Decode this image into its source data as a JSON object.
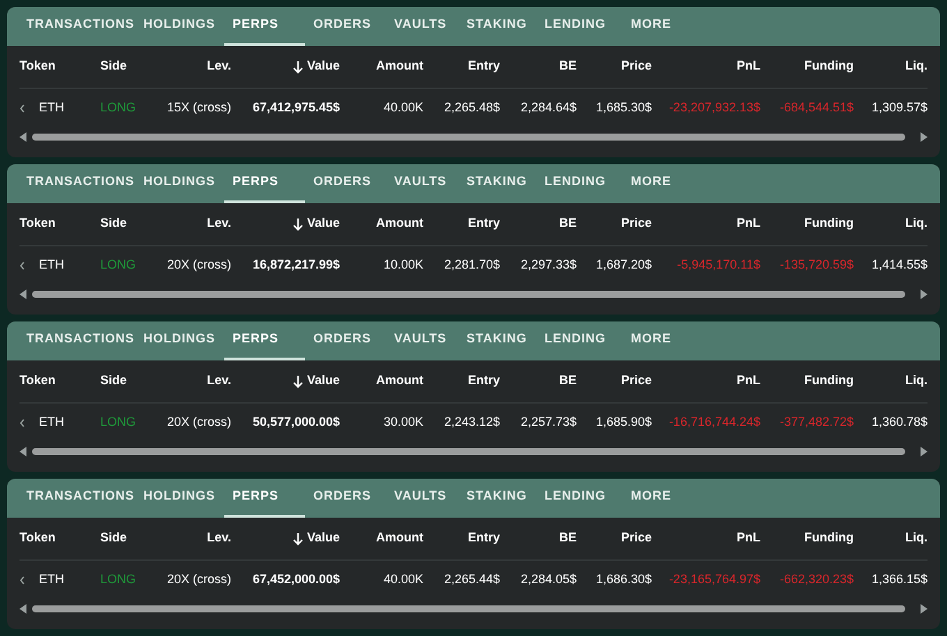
{
  "panels": [
    {
      "tabs": [
        {
          "label": "TRANSACTIONS",
          "selected": false
        },
        {
          "label": "HOLDINGS",
          "selected": false
        },
        {
          "label": "PERPS",
          "selected": true
        },
        {
          "label": "ORDERS",
          "selected": false
        },
        {
          "label": "VAULTS",
          "selected": false
        },
        {
          "label": "STAKING",
          "selected": false
        },
        {
          "label": "LENDING",
          "selected": false
        },
        {
          "label": "MORE",
          "selected": false
        }
      ],
      "columns": [
        {
          "label": "Token",
          "sorted": false
        },
        {
          "label": "Side",
          "sorted": false
        },
        {
          "label": "Lev.",
          "sorted": false
        },
        {
          "label": "Value",
          "sorted": true
        },
        {
          "label": "Amount",
          "sorted": false
        },
        {
          "label": "Entry",
          "sorted": false
        },
        {
          "label": "BE",
          "sorted": false
        },
        {
          "label": "Price",
          "sorted": false
        },
        {
          "label": "PnL",
          "sorted": false
        },
        {
          "label": "Funding",
          "sorted": false
        },
        {
          "label": "Liq.",
          "sorted": false
        }
      ],
      "rows": [
        [
          "ETH",
          "LONG",
          "15X (cross)",
          "67,412,975.45$",
          "40.00K",
          "2,265.48$",
          "2,284.64$",
          "1,685.30$",
          "-23,207,932.13$",
          "-684,544.51$",
          "1,309.57$"
        ]
      ]
    },
    {
      "tabs": [
        {
          "label": "TRANSACTIONS",
          "selected": false
        },
        {
          "label": "HOLDINGS",
          "selected": false
        },
        {
          "label": "PERPS",
          "selected": true
        },
        {
          "label": "ORDERS",
          "selected": false
        },
        {
          "label": "VAULTS",
          "selected": false
        },
        {
          "label": "STAKING",
          "selected": false
        },
        {
          "label": "LENDING",
          "selected": false
        },
        {
          "label": "MORE",
          "selected": false
        }
      ],
      "columns": [
        {
          "label": "Token",
          "sorted": false
        },
        {
          "label": "Side",
          "sorted": false
        },
        {
          "label": "Lev.",
          "sorted": false
        },
        {
          "label": "Value",
          "sorted": true
        },
        {
          "label": "Amount",
          "sorted": false
        },
        {
          "label": "Entry",
          "sorted": false
        },
        {
          "label": "BE",
          "sorted": false
        },
        {
          "label": "Price",
          "sorted": false
        },
        {
          "label": "PnL",
          "sorted": false
        },
        {
          "label": "Funding",
          "sorted": false
        },
        {
          "label": "Liq.",
          "sorted": false
        }
      ],
      "rows": [
        [
          "ETH",
          "LONG",
          "20X (cross)",
          "16,872,217.99$",
          "10.00K",
          "2,281.70$",
          "2,297.33$",
          "1,687.20$",
          "-5,945,170.11$",
          "-135,720.59$",
          "1,414.55$"
        ]
      ]
    },
    {
      "tabs": [
        {
          "label": "TRANSACTIONS",
          "selected": false
        },
        {
          "label": "HOLDINGS",
          "selected": false
        },
        {
          "label": "PERPS",
          "selected": true
        },
        {
          "label": "ORDERS",
          "selected": false
        },
        {
          "label": "VAULTS",
          "selected": false
        },
        {
          "label": "STAKING",
          "selected": false
        },
        {
          "label": "LENDING",
          "selected": false
        },
        {
          "label": "MORE",
          "selected": false
        }
      ],
      "columns": [
        {
          "label": "Token",
          "sorted": false
        },
        {
          "label": "Side",
          "sorted": false
        },
        {
          "label": "Lev.",
          "sorted": false
        },
        {
          "label": "Value",
          "sorted": true
        },
        {
          "label": "Amount",
          "sorted": false
        },
        {
          "label": "Entry",
          "sorted": false
        },
        {
          "label": "BE",
          "sorted": false
        },
        {
          "label": "Price",
          "sorted": false
        },
        {
          "label": "PnL",
          "sorted": false
        },
        {
          "label": "Funding",
          "sorted": false
        },
        {
          "label": "Liq.",
          "sorted": false
        }
      ],
      "rows": [
        [
          "ETH",
          "LONG",
          "20X (cross)",
          "50,577,000.00$",
          "30.00K",
          "2,243.12$",
          "2,257.73$",
          "1,685.90$",
          "-16,716,744.24$",
          "-377,482.72$",
          "1,360.78$"
        ]
      ]
    },
    {
      "tabs": [
        {
          "label": "TRANSACTIONS",
          "selected": false
        },
        {
          "label": "HOLDINGS",
          "selected": false
        },
        {
          "label": "PERPS",
          "selected": true
        },
        {
          "label": "ORDERS",
          "selected": false
        },
        {
          "label": "VAULTS",
          "selected": false
        },
        {
          "label": "STAKING",
          "selected": false
        },
        {
          "label": "LENDING",
          "selected": false
        },
        {
          "label": "MORE",
          "selected": false
        }
      ],
      "columns": [
        {
          "label": "Token",
          "sorted": false
        },
        {
          "label": "Side",
          "sorted": false
        },
        {
          "label": "Lev.",
          "sorted": false
        },
        {
          "label": "Value",
          "sorted": true
        },
        {
          "label": "Amount",
          "sorted": false
        },
        {
          "label": "Entry",
          "sorted": false
        },
        {
          "label": "BE",
          "sorted": false
        },
        {
          "label": "Price",
          "sorted": false
        },
        {
          "label": "PnL",
          "sorted": false
        },
        {
          "label": "Funding",
          "sorted": false
        },
        {
          "label": "Liq.",
          "sorted": false
        }
      ],
      "rows": [
        [
          "ETH",
          "LONG",
          "20X (cross)",
          "67,452,000.00$",
          "40.00K",
          "2,265.44$",
          "2,284.05$",
          "1,686.30$",
          "-23,165,764.97$",
          "-662,320.23$",
          "1,366.15$"
        ]
      ]
    }
  ]
}
